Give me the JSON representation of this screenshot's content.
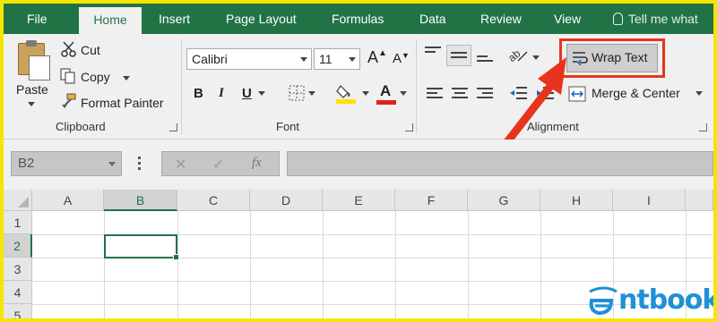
{
  "tabs": [
    "File",
    "Home",
    "Insert",
    "Page Layout",
    "Formulas",
    "Data",
    "Review",
    "View"
  ],
  "tell_me": "Tell me what",
  "clipboard": {
    "paste": "Paste",
    "cut": "Cut",
    "copy": "Copy",
    "format_painter": "Format Painter",
    "label": "Clipboard"
  },
  "font": {
    "name": "Calibri",
    "size": "11",
    "bold": "B",
    "italic": "I",
    "underline": "U",
    "grow": "A",
    "shrink": "A",
    "color_letter": "A",
    "label": "Font"
  },
  "alignment": {
    "wrap_text": "Wrap Text",
    "merge_center": "Merge & Center",
    "label": "Alignment"
  },
  "formula_bar": {
    "name_box": "B2",
    "fx": "fx",
    "cancel": "✕",
    "enter": "✓"
  },
  "grid": {
    "columns": [
      "A",
      "B",
      "C",
      "D",
      "E",
      "F",
      "G",
      "H",
      "I"
    ],
    "rows": [
      "1",
      "2",
      "3",
      "4",
      "5"
    ],
    "selected_cell": "B2"
  },
  "watermark": "ntbook",
  "colors": {
    "brand_green": "#217346",
    "highlight_red": "#e8341c",
    "frame_yellow": "#f5e600",
    "fill_yellow": "#ffe000",
    "font_red": "#e02020",
    "logo_blue": "#1e90d6"
  }
}
